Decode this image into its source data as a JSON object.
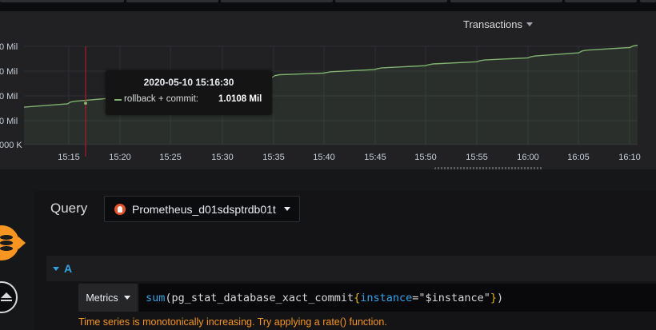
{
  "panel": {
    "title": "Transactions"
  },
  "chart_data": {
    "type": "area",
    "yticks": [
      "0 Mil",
      "0 Mil",
      "0 Mil",
      "0 Mil",
      "000 K"
    ],
    "xticks": [
      "15:15",
      "15:20",
      "15:25",
      "15:30",
      "15:35",
      "15:40",
      "15:45",
      "15:50",
      "15:55",
      "16:00",
      "16:05",
      "16:10"
    ],
    "series": [
      {
        "name": "rollback + commit",
        "color": "#7eb26d"
      }
    ],
    "x_minutes_from_1510": [
      0,
      5,
      10,
      15,
      20,
      25,
      30,
      35,
      40,
      45,
      50,
      55,
      60
    ],
    "y_frac": [
      0.3,
      0.36,
      0.43,
      0.5,
      0.57,
      0.63,
      0.66,
      0.7,
      0.74,
      0.78,
      0.82,
      0.88,
      0.93
    ],
    "grid": true
  },
  "tooltip": {
    "time": "2020-05-10 15:16:30",
    "label": "rollback + commit:",
    "value": "1.0108 Mil"
  },
  "query": {
    "label": "Query",
    "datasource": "Prometheus_d01sdsptrdb01t",
    "row_letter": "A",
    "metrics_label": "Metrics",
    "expr": {
      "fn": "sum",
      "open": "(",
      "metric": "pg_stat_database_xact_commit",
      "brace_open": "{",
      "key": "instance",
      "eq": "=",
      "val": "\"$instance\"",
      "brace_close": "}",
      "close": ")"
    },
    "hint": "Time series is monotonically increasing. Try applying a rate() function."
  },
  "colors": {
    "accent": "#33a2e5",
    "series": "#7eb26d",
    "warning": "#f79520",
    "marker": "#c4162a"
  }
}
